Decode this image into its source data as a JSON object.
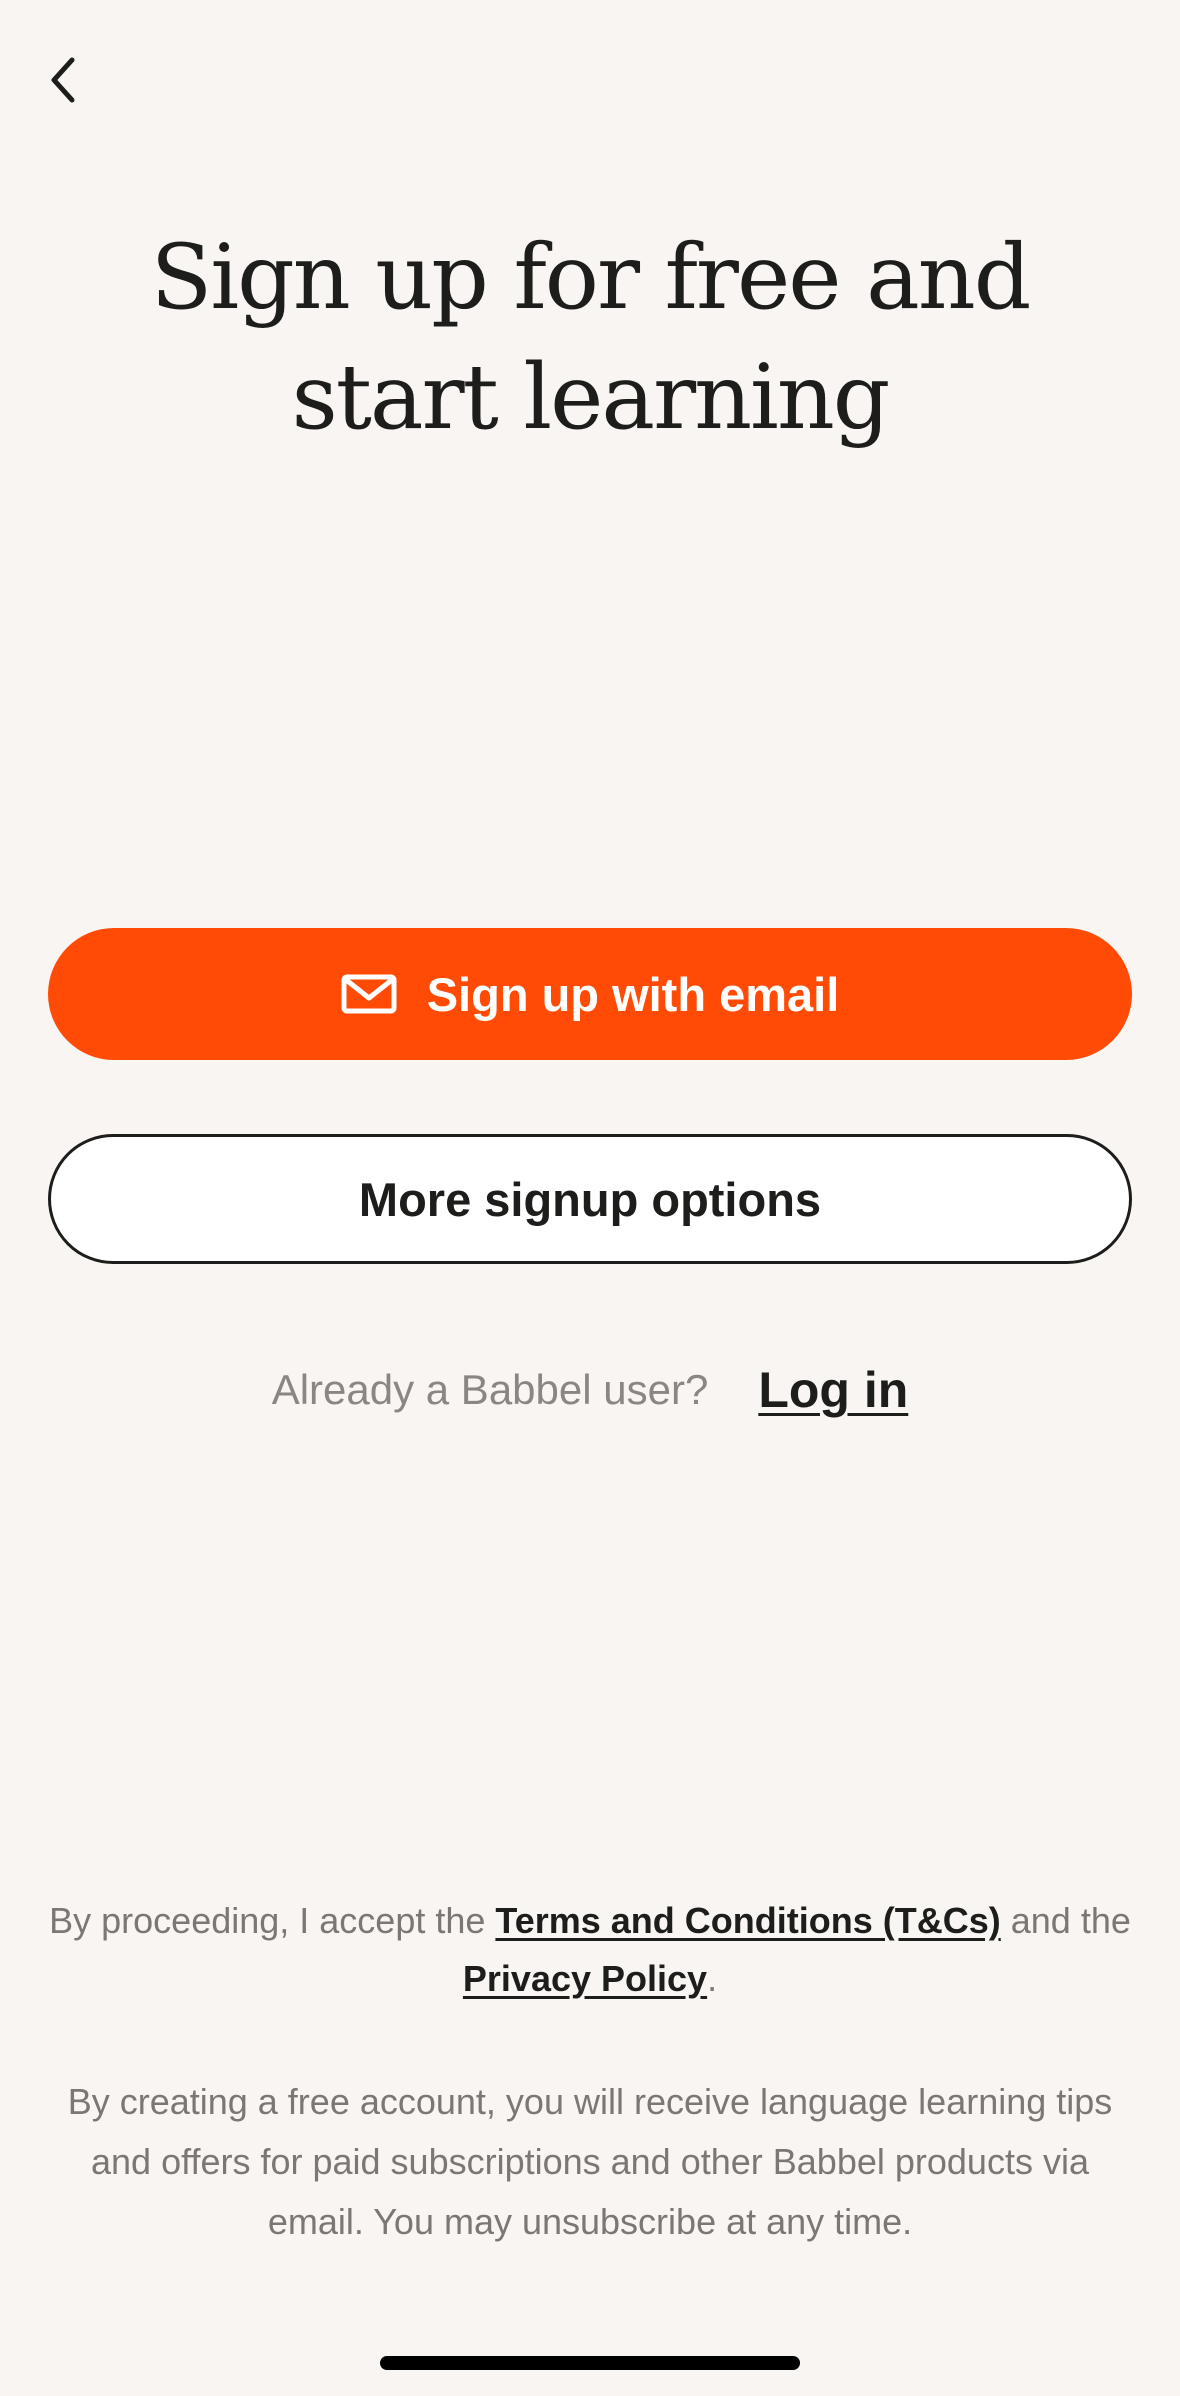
{
  "header": {
    "back_icon": "chevron-left-icon"
  },
  "title": "Sign up for free and start learning",
  "buttons": {
    "email": {
      "icon": "mail-icon",
      "label": "Sign up with email"
    },
    "more_options": {
      "label": "More signup options"
    }
  },
  "login": {
    "question": "Already a Babbel user?",
    "link_label": "Log in"
  },
  "legal": {
    "prefix": "By proceeding, I accept the ",
    "terms_link": "Terms and Conditions (T&Cs)",
    "middle": " and the ",
    "privacy_link": "Privacy Policy",
    "suffix": "."
  },
  "marketing_notice": "By creating a free account, you will receive language learning tips and offers for paid subscriptions and other Babbel products via email. You may unsubscribe at any time.",
  "colors": {
    "background": "#f8f5f2",
    "accent": "#ff4b05",
    "text": "#1d1d1b",
    "muted_text": "#7b7774"
  }
}
